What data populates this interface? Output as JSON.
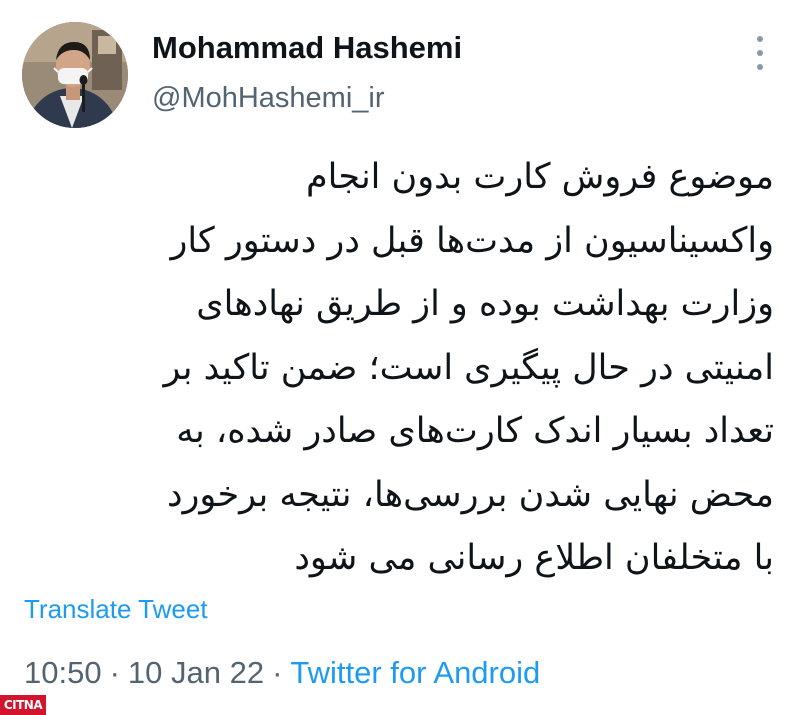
{
  "tweet": {
    "author": {
      "display_name": "Mohammad Hashemi",
      "handle": "@MohHashemi_ir",
      "avatar_icon": "profile-photo"
    },
    "more_icon": "more-vertical-icon",
    "text_lines": [
      "موضوع فروش کارت بدون انجام",
      "واکسیناسیون از مدت‌ها قبل در دستور کار",
      "وزارت بهداشت بوده و از طریق نهادهای",
      "امنیتی در حال پیگیری است؛ ضمن تاکید بر",
      "تعداد بسیار اندک کارت‌های صادر شده، به",
      "محض نهایی شدن بررسی‌ها، نتیجه برخورد",
      "با متخلفان اطلاع رسانی می شود"
    ],
    "translate_label": "Translate Tweet",
    "meta": {
      "time": "10:50",
      "separator": "·",
      "date": "10 Jan 22",
      "source": "Twitter for Android"
    },
    "watermark": "CITNA"
  },
  "colors": {
    "text_primary": "#0f1419",
    "text_secondary": "#536471",
    "link": "#1d9bf0",
    "watermark_bg": "#d3142c"
  }
}
